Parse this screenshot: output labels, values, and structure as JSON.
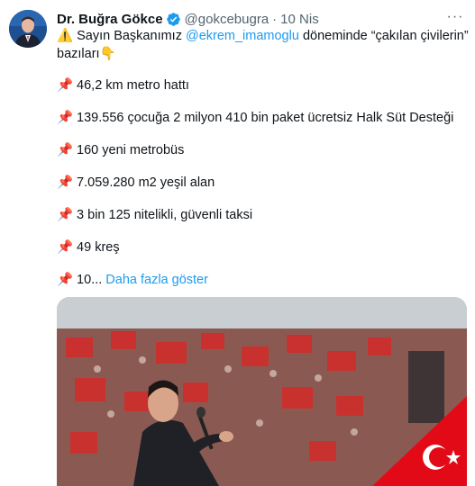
{
  "author": {
    "name": "Dr. Buğra Gökce",
    "handle": "@gokcebugra",
    "separator": "·",
    "time": "10 Nis"
  },
  "more_menu": "···",
  "tweet": {
    "warning_emoji": "⚠️",
    "intro_before": "Sayın Başkanımız",
    "mention": "@ekrem_imamoglu",
    "intro_after": "döneminde “çakılan çivilerin”",
    "intro_line2": "bazıları",
    "point_emoji": "👇",
    "pin_emoji": "📌",
    "items": [
      "46,2 km metro hattı",
      "139.556 çocuğa 2 milyon 410 bin paket ücretsiz Halk Süt Desteği",
      "160 yeni metrobüs",
      "7.059.280 m2 yeşil alan",
      "3 bin 125 nitelikli, güvenli taksi",
      "49 kreş",
      "10..."
    ],
    "show_more": "Daha fazla göster"
  },
  "colors": {
    "link": "#1d9bf0",
    "muted": "#536471",
    "flag_red": "#e30a17"
  }
}
